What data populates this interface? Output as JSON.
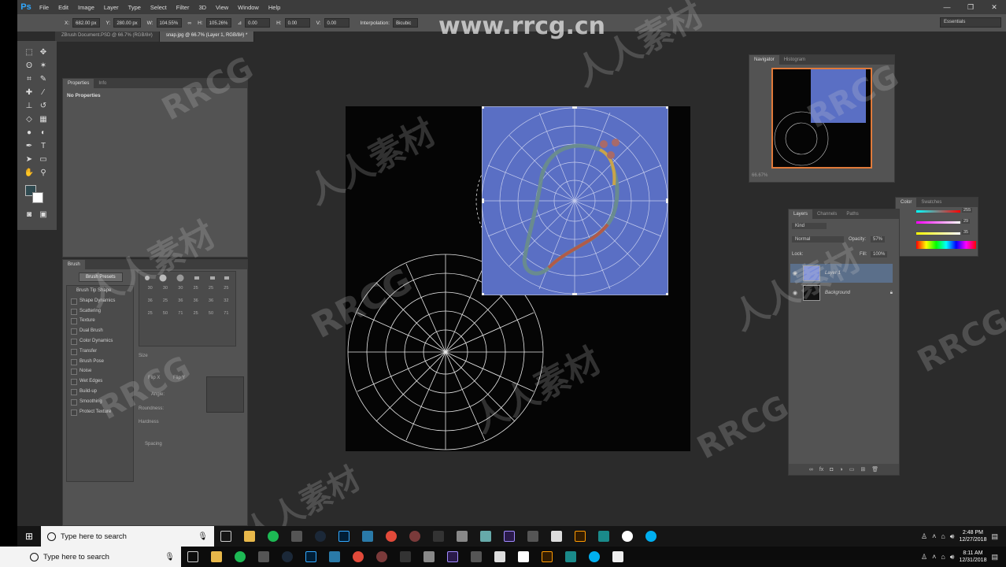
{
  "app": {
    "logo": "Ps",
    "menu": [
      "File",
      "Edit",
      "Image",
      "Layer",
      "Type",
      "Select",
      "Filter",
      "3D",
      "View",
      "Window",
      "Help"
    ],
    "window_controls": [
      "—",
      "❐",
      "✕"
    ]
  },
  "options_bar": {
    "x_label": "X:",
    "x_value": "682.00 px",
    "y_label": "Y:",
    "y_value": "280.00 px",
    "w_label": "W:",
    "w_value": "104.55%",
    "h_label": "H:",
    "h_value": "105.26%",
    "angle_value": "0.00",
    "hskew_label": "H:",
    "hskew_value": "0.00",
    "vskew_label": "V:",
    "vskew_value": "0.00",
    "interpolation_label": "Interpolation:",
    "interpolation_value": "Bicubic",
    "workspace": "Essentials"
  },
  "tabs": [
    {
      "label": "ZBrush Document.PSD @ 66.7% (RGB/8#)"
    },
    {
      "label": "snap.jpg @ 66.7% (Layer 1, RGB/8#) *"
    }
  ],
  "properties_panel": {
    "tabs": [
      "Properties",
      "Info"
    ],
    "title": "No Properties"
  },
  "brush_panel": {
    "tab": "Brush",
    "presets_button": "Brush Presets",
    "options": [
      "Brush Tip Shape",
      "Shape Dynamics",
      "Scattering",
      "Texture",
      "Dual Brush",
      "Color Dynamics",
      "Transfer",
      "Brush Pose",
      "Noise",
      "Wet Edges",
      "Build-up",
      "Smoothing",
      "Protect Texture"
    ],
    "size_label": "Size",
    "flip_x": "Flip X",
    "flip_y": "Flip Y",
    "angle_label": "Angle:",
    "roundness_label": "Roundness:",
    "hardness_label": "Hardness",
    "spacing_label": "Spacing",
    "sizes": [
      "30",
      "30",
      "30",
      "25",
      "25",
      "25",
      "36",
      "25",
      "36",
      "36",
      "36",
      "32",
      "25",
      "50",
      "71",
      "25",
      "50",
      "71"
    ]
  },
  "navigator_panel": {
    "tabs": [
      "Navigator",
      "Histogram"
    ],
    "zoom": "66.67%"
  },
  "color_panel": {
    "tabs": [
      "Color",
      "Swatches"
    ],
    "r": "255",
    "g": "29",
    "b": "35"
  },
  "layers_panel": {
    "tabs": [
      "Layers",
      "Channels",
      "Paths"
    ],
    "kind": "Kind",
    "blend_mode": "Normal",
    "opacity_label": "Opacity:",
    "opacity_value": "57%",
    "lock_label": "Lock:",
    "fill_label": "Fill:",
    "fill_value": "100%",
    "layers": [
      {
        "name": "Layer 1"
      },
      {
        "name": "Background"
      }
    ]
  },
  "watermark": {
    "url": "www.rrcg.cn",
    "text1": "人人素材",
    "text2": "RRCG"
  },
  "taskbar_inner": {
    "search_placeholder": "Type here to search",
    "time": "2:48 PM",
    "date": "12/27/2018"
  },
  "taskbar_outer": {
    "search_placeholder": "Type here to search",
    "time": "8:11 AM",
    "date": "12/31/2018"
  },
  "colors": {
    "accent": "#31a8ff",
    "layer_blue": "#5a6fc4",
    "navigator_border": "#e07a3a"
  }
}
